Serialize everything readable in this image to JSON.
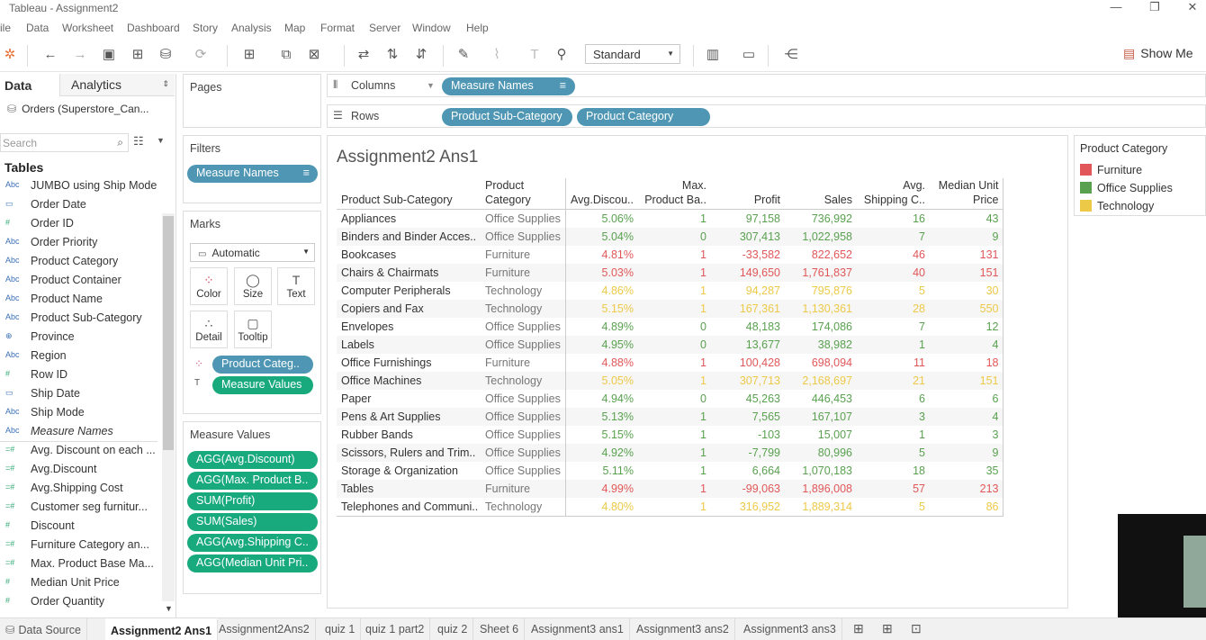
{
  "window": {
    "title": "Tableau - Assignment2",
    "controls": {
      "minimize": "—",
      "restore": "❐",
      "close": "✕"
    }
  },
  "menu": [
    "ile",
    "Data",
    "Worksheet",
    "Dashboard",
    "Story",
    "Analysis",
    "Map",
    "Format",
    "Server",
    "Window",
    "Help"
  ],
  "toolbar": {
    "fit_select": "Standard",
    "show_me": "Show Me"
  },
  "data_pane": {
    "tab_data": "Data",
    "tab_analytics": "Analytics",
    "datasource": "Orders (Superstore_Can...",
    "search_placeholder": "Search",
    "tables_heading": "Tables",
    "fields": [
      {
        "icon": "Abc",
        "label": "JUMBO using Ship Mode"
      },
      {
        "icon": "▭",
        "label": "Order Date"
      },
      {
        "icon": "#",
        "label": "Order ID"
      },
      {
        "icon": "Abc",
        "label": "Order Priority"
      },
      {
        "icon": "Abc",
        "label": "Product Category"
      },
      {
        "icon": "Abc",
        "label": "Product Container"
      },
      {
        "icon": "Abc",
        "label": "Product Name"
      },
      {
        "icon": "Abc",
        "label": "Product Sub-Category"
      },
      {
        "icon": "⊕",
        "label": "Province"
      },
      {
        "icon": "Abc",
        "label": "Region"
      },
      {
        "icon": "#",
        "label": "Row ID"
      },
      {
        "icon": "▭",
        "label": "Ship Date"
      },
      {
        "icon": "Abc",
        "label": "Ship Mode"
      },
      {
        "icon": "Abc",
        "label": "Measure Names"
      },
      {
        "icon": "=#",
        "label": "Avg. Discount on each ..."
      },
      {
        "icon": "=#",
        "label": "Avg.Discount"
      },
      {
        "icon": "=#",
        "label": "Avg.Shipping Cost"
      },
      {
        "icon": "=#",
        "label": "Customer  seg furnitur..."
      },
      {
        "icon": "#",
        "label": "Discount"
      },
      {
        "icon": "=#",
        "label": "Furniture Category  an..."
      },
      {
        "icon": "=#",
        "label": "Max. Product Base Ma..."
      },
      {
        "icon": "#",
        "label": "Median Unit Price"
      },
      {
        "icon": "#",
        "label": "Order Quantity"
      }
    ]
  },
  "shelves": {
    "pages": "Pages",
    "filters": "Filters",
    "filter_pill": "Measure Names",
    "columns": "Columns",
    "columns_pill": "Measure Names",
    "rows": "Rows",
    "rows_pills": [
      "Product Sub-Category",
      "Product Category"
    ],
    "marks": "Marks",
    "marks_type": "Automatic",
    "mark_buttons": [
      "Color",
      "Size",
      "Text",
      "Detail",
      "Tooltip"
    ],
    "marks_pills": [
      "Product Categ..",
      "Measure Values"
    ],
    "measure_values": "Measure Values",
    "measure_pills": [
      "AGG(Avg.Discount)",
      "AGG(Max. Product B..",
      "SUM(Profit)",
      "SUM(Sales)",
      "AGG(Avg.Shipping C..",
      "AGG(Median Unit Pri.."
    ]
  },
  "view": {
    "title": "Assignment2 Ans1",
    "headers": [
      "Product Sub-Category",
      "Product Category",
      "Avg.Discou..",
      "Max. Product Ba..",
      "Profit",
      "Sales",
      "Avg. Shipping C..",
      "Median Unit Price"
    ],
    "header_lines": {
      "cat": [
        "Product",
        "Category"
      ],
      "max": [
        "Max.",
        "Product Ba.."
      ],
      "ship": [
        "Avg.",
        "Shipping C.."
      ],
      "med": [
        "Median Unit",
        "Price"
      ]
    },
    "colors": {
      "Furniture": "#e15759",
      "Office Supplies": "#59a14f",
      "Technology": "#edc948"
    },
    "rows": [
      {
        "sub": "Appliances",
        "cat": "Office Supplies",
        "disc": "5.06%",
        "max": "1",
        "profit": "97,158",
        "sales": "736,992",
        "ship": "16",
        "med": "43"
      },
      {
        "sub": "Binders and Binder Acces..",
        "cat": "Office Supplies",
        "disc": "5.04%",
        "max": "0",
        "profit": "307,413",
        "sales": "1,022,958",
        "ship": "7",
        "med": "9"
      },
      {
        "sub": "Bookcases",
        "cat": "Furniture",
        "disc": "4.81%",
        "max": "1",
        "profit": "-33,582",
        "sales": "822,652",
        "ship": "46",
        "med": "131"
      },
      {
        "sub": "Chairs & Chairmats",
        "cat": "Furniture",
        "disc": "5.03%",
        "max": "1",
        "profit": "149,650",
        "sales": "1,761,837",
        "ship": "40",
        "med": "151"
      },
      {
        "sub": "Computer Peripherals",
        "cat": "Technology",
        "disc": "4.86%",
        "max": "1",
        "profit": "94,287",
        "sales": "795,876",
        "ship": "5",
        "med": "30"
      },
      {
        "sub": "Copiers and Fax",
        "cat": "Technology",
        "disc": "5.15%",
        "max": "1",
        "profit": "167,361",
        "sales": "1,130,361",
        "ship": "28",
        "med": "550"
      },
      {
        "sub": "Envelopes",
        "cat": "Office Supplies",
        "disc": "4.89%",
        "max": "0",
        "profit": "48,183",
        "sales": "174,086",
        "ship": "7",
        "med": "12"
      },
      {
        "sub": "Labels",
        "cat": "Office Supplies",
        "disc": "4.95%",
        "max": "0",
        "profit": "13,677",
        "sales": "38,982",
        "ship": "1",
        "med": "4"
      },
      {
        "sub": "Office Furnishings",
        "cat": "Furniture",
        "disc": "4.88%",
        "max": "1",
        "profit": "100,428",
        "sales": "698,094",
        "ship": "11",
        "med": "18"
      },
      {
        "sub": "Office Machines",
        "cat": "Technology",
        "disc": "5.05%",
        "max": "1",
        "profit": "307,713",
        "sales": "2,168,697",
        "ship": "21",
        "med": "151"
      },
      {
        "sub": "Paper",
        "cat": "Office Supplies",
        "disc": "4.94%",
        "max": "0",
        "profit": "45,263",
        "sales": "446,453",
        "ship": "6",
        "med": "6"
      },
      {
        "sub": "Pens & Art Supplies",
        "cat": "Office Supplies",
        "disc": "5.13%",
        "max": "1",
        "profit": "7,565",
        "sales": "167,107",
        "ship": "3",
        "med": "4"
      },
      {
        "sub": "Rubber Bands",
        "cat": "Office Supplies",
        "disc": "5.15%",
        "max": "1",
        "profit": "-103",
        "sales": "15,007",
        "ship": "1",
        "med": "3"
      },
      {
        "sub": "Scissors, Rulers and Trim..",
        "cat": "Office Supplies",
        "disc": "4.92%",
        "max": "1",
        "profit": "-7,799",
        "sales": "80,996",
        "ship": "5",
        "med": "9"
      },
      {
        "sub": "Storage & Organization",
        "cat": "Office Supplies",
        "disc": "5.11%",
        "max": "1",
        "profit": "6,664",
        "sales": "1,070,183",
        "ship": "18",
        "med": "35"
      },
      {
        "sub": "Tables",
        "cat": "Furniture",
        "disc": "4.99%",
        "max": "1",
        "profit": "-99,063",
        "sales": "1,896,008",
        "ship": "57",
        "med": "213"
      },
      {
        "sub": "Telephones and Communi..",
        "cat": "Technology",
        "disc": "4.80%",
        "max": "1",
        "profit": "316,952",
        "sales": "1,889,314",
        "ship": "5",
        "med": "86"
      }
    ]
  },
  "legend": {
    "title": "Product Category",
    "items": [
      "Furniture",
      "Office Supplies",
      "Technology"
    ]
  },
  "sheet_tabs": [
    "Data Source",
    "Assignment2 Ans1",
    "Assignment2Ans2",
    "quiz 1",
    "quiz 1 part2",
    "quiz 2",
    "Sheet 6",
    "Assignment3 ans1",
    "Assignment3 ans2",
    "Assignment3 ans3"
  ],
  "active_tab": "Assignment2 Ans1"
}
